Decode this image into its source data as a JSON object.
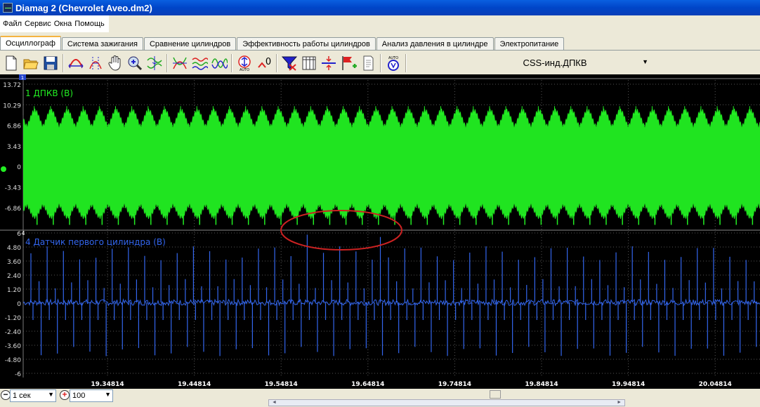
{
  "window": {
    "title": "Diamag 2 (Chevrolet Aveo.dm2)"
  },
  "menu": [
    "Файл",
    "Сервис",
    "Окна",
    "Помощь"
  ],
  "tabs": [
    {
      "label": "Осциллограф",
      "active": true
    },
    {
      "label": "Система зажигания",
      "active": false
    },
    {
      "label": "Сравнение цилиндров",
      "active": false
    },
    {
      "label": "Эффективность работы цилиндров",
      "active": false
    },
    {
      "label": "Анализ давления в цилиндре",
      "active": false
    },
    {
      "label": "Электропитание",
      "active": false
    }
  ],
  "toolbar": {
    "icons": [
      "new-file-icon",
      "open-folder-icon",
      "save-disk-icon",
      "cursor-x-icon",
      "cursor-range-icon",
      "hand-pan-icon",
      "zoom-icon",
      "sync-markers-icon",
      "invert-icon",
      "filter-icon",
      "wave-icon",
      "auto-scale-icon",
      "zero-icon",
      "channel-filter-icon",
      "columns-icon",
      "split-icon",
      "add-flag-icon",
      "notes-icon",
      "auto-gauge-icon"
    ],
    "auto_label": "AUTO",
    "zero_label": "0",
    "sync_label": "CSS-инд.ДПКВ"
  },
  "scope": {
    "channel1": {
      "name": "1 ДПКВ (В)",
      "color": "#22ee22",
      "ticks": [
        "13.72",
        "10.29",
        "6.86",
        "3.43",
        "0",
        "-3.43",
        "-6.86"
      ],
      "ymax": 13.72
    },
    "channel4": {
      "name": "4 Датчик первого цилиндра (В)",
      "color": "#3366ee",
      "ticks": [
        "6",
        "4.80",
        "3.60",
        "2.40",
        "1.20",
        "0",
        "-1.20",
        "-2.40",
        "-3.60",
        "-4.80",
        "-6"
      ],
      "ymax": 6
    },
    "time_ticks": [
      "19.34814",
      "19.44814",
      "19.54814",
      "19.64814",
      "19.74814",
      "19.84814",
      "19.94814",
      "20.04814"
    ],
    "ch1_marker": "1",
    "ch4_marker": "4"
  },
  "bottom": {
    "timebase": "1 сек",
    "scale": "100"
  },
  "colors": {
    "highlight_ellipse": "#cc2222",
    "grid": "#666666"
  }
}
